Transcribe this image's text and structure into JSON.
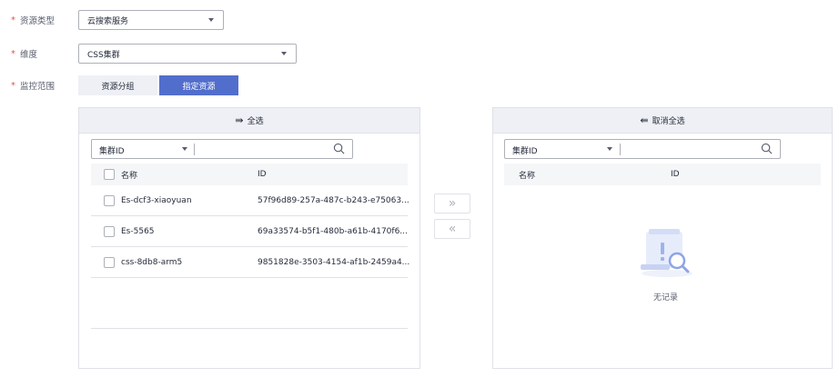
{
  "form": {
    "resource_type": {
      "required_mark": "*",
      "label": "资源类型",
      "value": "云搜索服务"
    },
    "dimension": {
      "required_mark": "*",
      "label": "维度",
      "value": "CSS集群"
    },
    "monitor_scope": {
      "required_mark": "*",
      "label": "监控范围",
      "options": [
        "资源分组",
        "指定资源"
      ],
      "selected": "指定资源"
    }
  },
  "left_panel": {
    "header": "全选",
    "header_icon": "select-all-arrow-icon",
    "search": {
      "field": "集群ID",
      "value": ""
    },
    "columns": {
      "name": "名称",
      "id": "ID"
    },
    "rows": [
      {
        "name": "Es-dcf3-xiaoyuan",
        "id": "57f96d89-257a-487c-b243-e75063..."
      },
      {
        "name": "Es-5565",
        "id": "69a33574-b5f1-480b-a61b-4170f6..."
      },
      {
        "name": "css-8db8-arm5",
        "id": "9851828e-3503-4154-af1b-2459a4..."
      }
    ]
  },
  "transfer": {
    "right_label": "»",
    "left_label": "«"
  },
  "right_panel": {
    "header": "取消全选",
    "header_icon": "deselect-all-arrow-icon",
    "search": {
      "field": "集群ID",
      "value": ""
    },
    "columns": {
      "name": "名称",
      "id": "ID"
    },
    "empty_text": "无记录"
  },
  "colors": {
    "primary": "#526ecc",
    "required": "#e6524a",
    "border": "#dfe1e6",
    "header_bg": "#eef0f5"
  }
}
